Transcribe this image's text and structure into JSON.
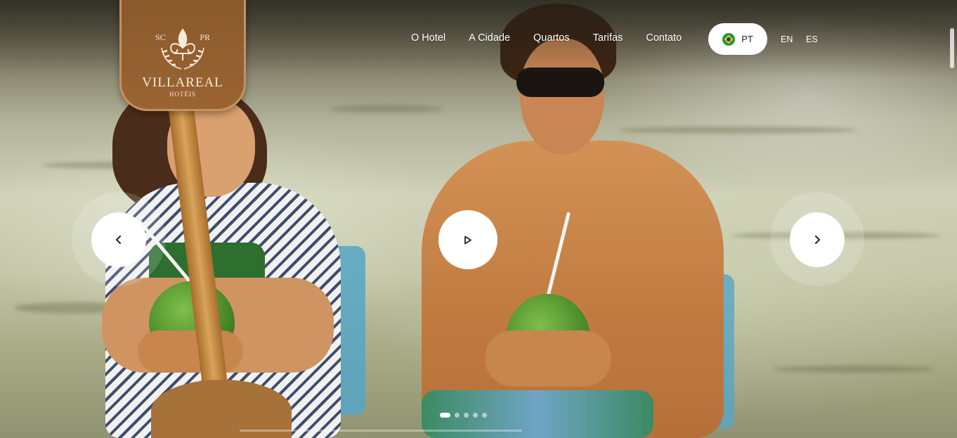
{
  "logo": {
    "left_text": "SC",
    "right_text": "PR",
    "brand": "VILLAREAL",
    "sub": "HOTÉIS"
  },
  "nav": {
    "items": [
      {
        "label": "O Hotel"
      },
      {
        "label": "A Cidade"
      },
      {
        "label": "Quartos"
      },
      {
        "label": "Tarifas"
      },
      {
        "label": "Contato"
      }
    ]
  },
  "languages": {
    "active": {
      "label": "PT",
      "icon": "brazil-flag-icon"
    },
    "others": [
      {
        "label": "EN"
      },
      {
        "label": "ES"
      }
    ]
  },
  "slider": {
    "prev_icon": "chevron-left-icon",
    "next_icon": "chevron-right-icon",
    "play_icon": "play-icon",
    "dot_count": 5,
    "active_dot": 0,
    "progress": 0.0
  },
  "colors": {
    "logo_brown": "#8a5a2b",
    "logo_border": "#c49160",
    "white": "#ffffff"
  }
}
